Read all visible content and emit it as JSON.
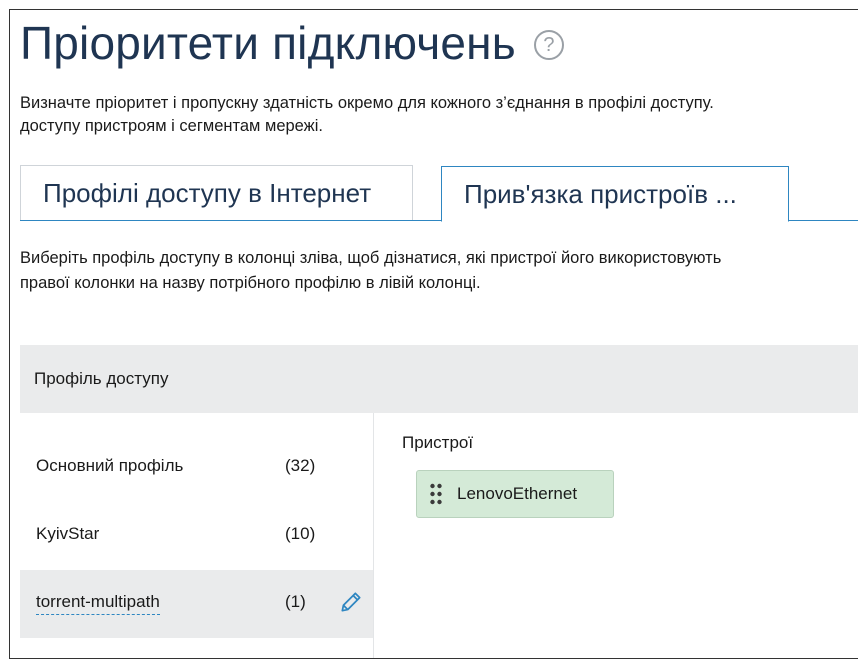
{
  "page": {
    "title": "Пріоритети підключень",
    "help_icon": "question-circle-icon",
    "description_line1": "Визначте пріоритет і пропускну здатність окремо для кожного з’єднання в профілі доступу.",
    "description_line2": "доступу пристроям і сегментам мережі."
  },
  "tabs": [
    {
      "label": "Профілі доступу в Інтернет",
      "active": false
    },
    {
      "label": "Прив'язка пристроїв ...",
      "active": true
    }
  ],
  "instructions": {
    "line1": "Виберіть профіль доступу в колонці зліва, щоб дізнатися, які пристрої його використовують",
    "line2": "правої колонки на назву потрібного профілю в лівій колонці."
  },
  "table": {
    "header": "Профіль доступу",
    "profiles": [
      {
        "name": "Основний профіль",
        "count": "(32)",
        "selected": false
      },
      {
        "name": "KyivStar",
        "count": "(10)",
        "selected": false
      },
      {
        "name": "torrent-multipath",
        "count": "(1)",
        "selected": true,
        "edit_icon": "pencil-icon"
      }
    ],
    "devices_label": "Пристрої",
    "devices": [
      {
        "name": "LenovoEthernet",
        "icon": "drag-handle-icon"
      }
    ]
  },
  "colors": {
    "title": "#1f3552",
    "accent": "#2e86c1",
    "header_bg": "#eaebec",
    "chip_bg": "#d4ead7"
  }
}
